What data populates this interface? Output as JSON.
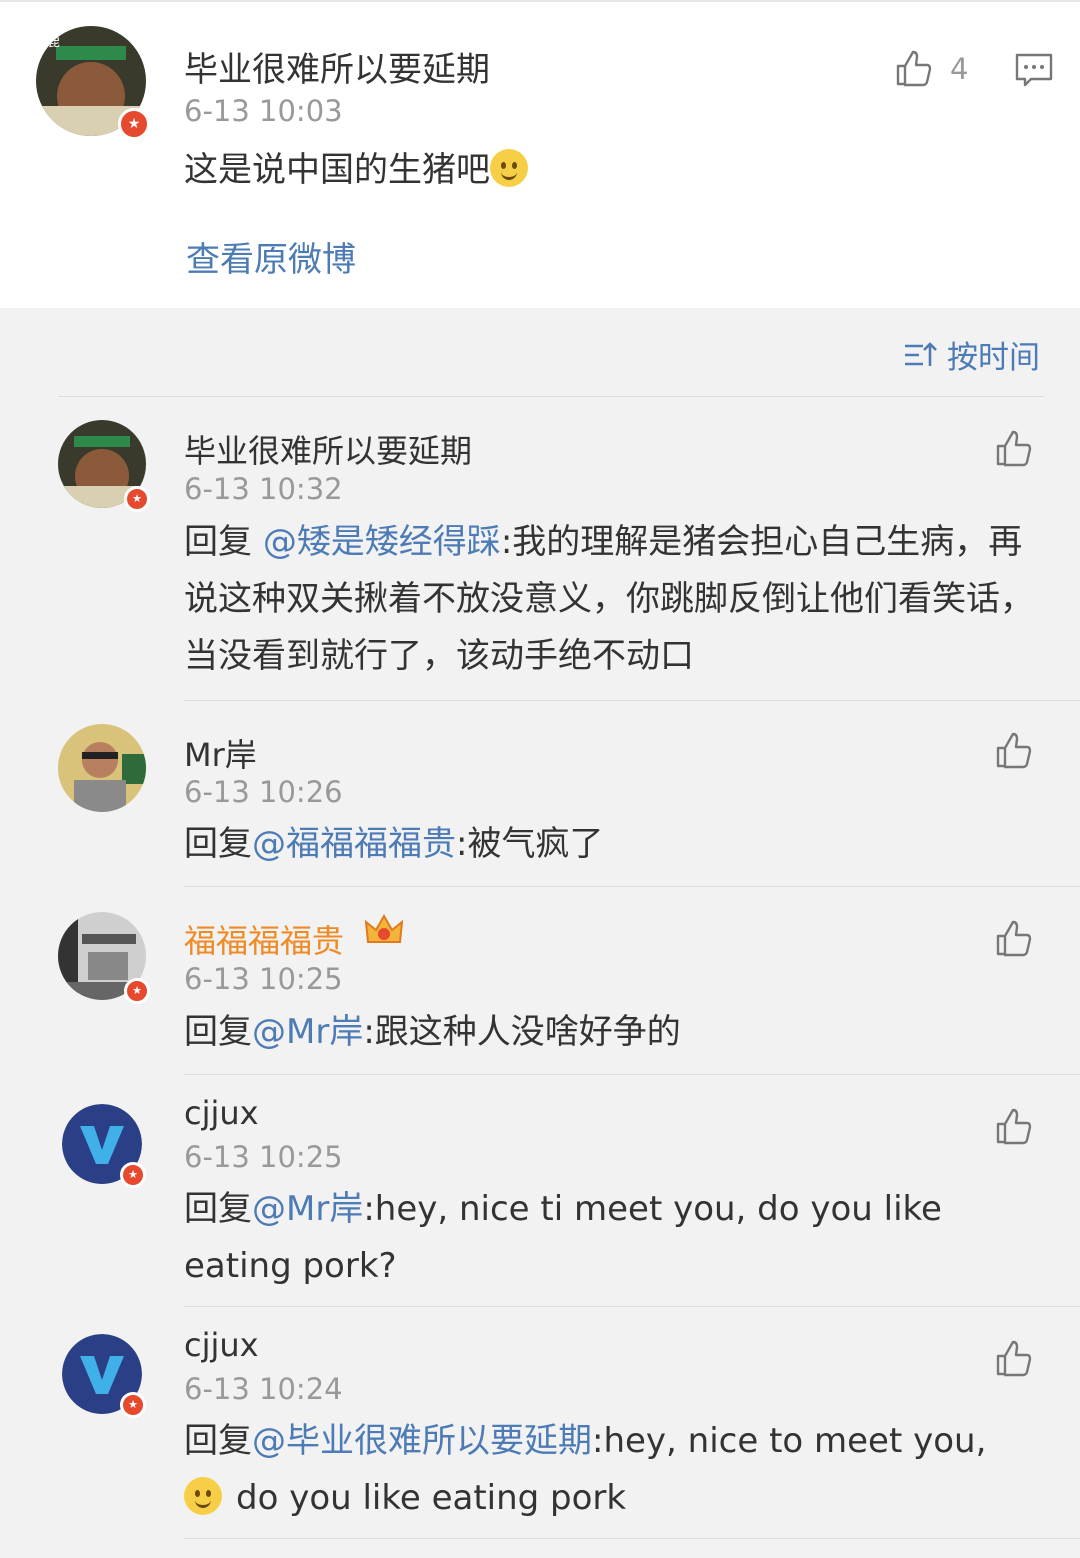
{
  "post": {
    "author": "毕业很难所以要延期",
    "time": "6-13 10:03",
    "text": "这是说中国的生猪吧",
    "like_count": "4",
    "view_original": "查看原微博"
  },
  "sort_label": "按时间",
  "replies": [
    {
      "author": "毕业很难所以要延期",
      "time": "6-13 10:32",
      "prefix": "回复 ",
      "mention": "@矮是矮经得踩",
      "text": ":我的理解是猪会担心自己生病，再说这种双关揪着不放没意义，你跳脚反倒让他们看笑话，当没看到就行了，该动手绝不动口"
    },
    {
      "author": "Mr岸",
      "time": "6-13 10:26",
      "prefix": "回复",
      "mention": "@福福福福贵",
      "text": ":被气疯了"
    },
    {
      "author": "福福福福贵",
      "time": "6-13 10:25",
      "prefix": "回复",
      "mention": "@Mr岸",
      "text": ":跟这种人没啥好争的"
    },
    {
      "author": "cjjux",
      "time": "6-13 10:25",
      "prefix": "回复",
      "mention": "@Mr岸",
      "text": ":hey, nice ti meet you, do you like eating pork?"
    },
    {
      "author": "cjjux",
      "time": "6-13 10:24",
      "prefix": "回复",
      "mention": "@毕业很难所以要延期",
      "text": ":hey, nice to meet you,",
      "text2": "do you like eating pork"
    }
  ],
  "colors": {
    "link": "#4d7bb6",
    "vip_name": "#f08a24",
    "badge": "#e6492d"
  }
}
